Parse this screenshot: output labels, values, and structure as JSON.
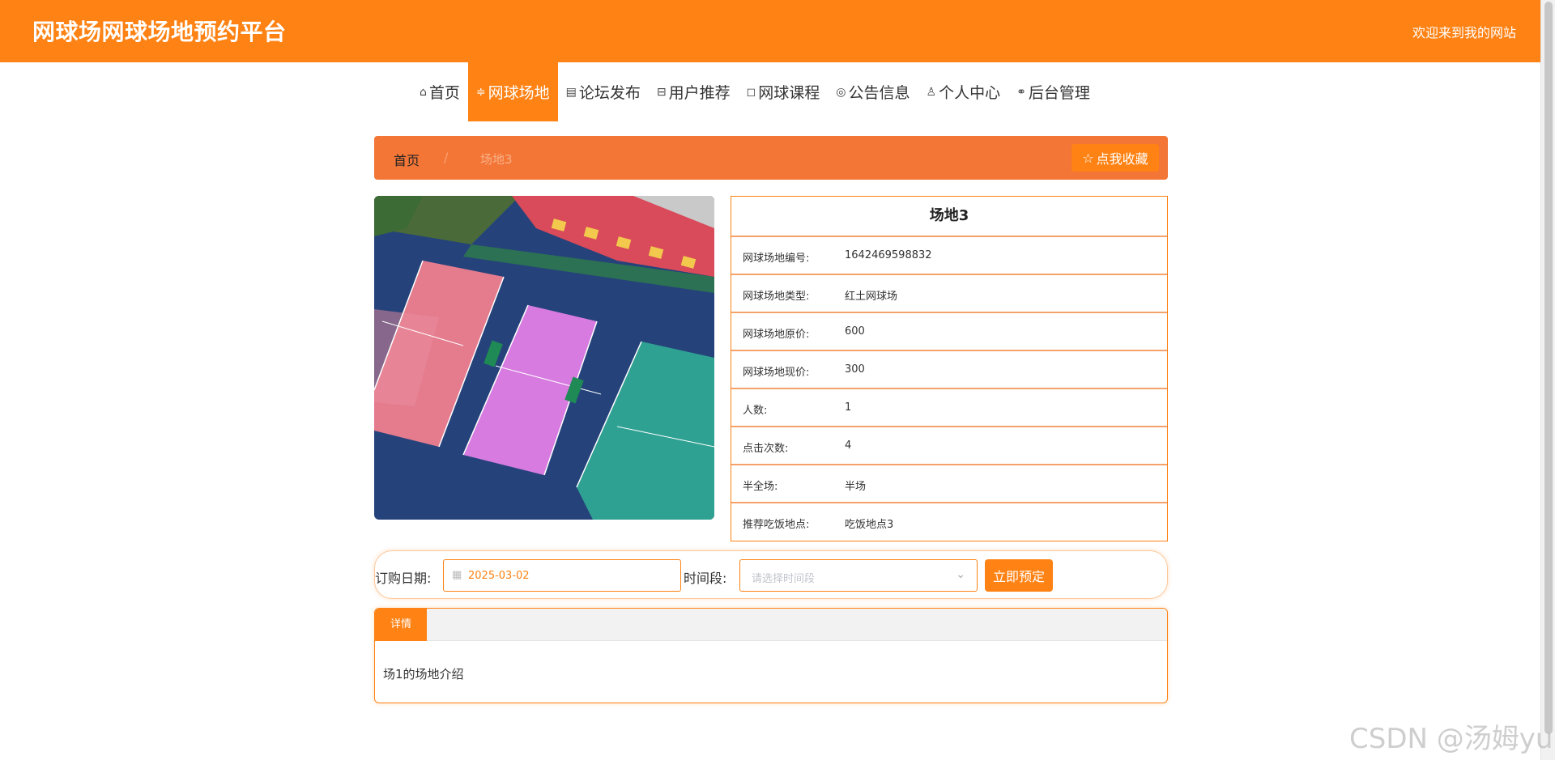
{
  "header": {
    "site_title": "网球场网球场地预约平台",
    "welcome_text": "欢迎来到我的网站"
  },
  "nav": {
    "items": [
      {
        "label": "首页",
        "icon": "home-icon"
      },
      {
        "label": "网球场地",
        "icon": "sliders-icon",
        "active": true
      },
      {
        "label": "论坛发布",
        "icon": "calendar-icon"
      },
      {
        "label": "用户推荐",
        "icon": "gift-icon"
      },
      {
        "label": "网球课程",
        "icon": "tag-icon"
      },
      {
        "label": "公告信息",
        "icon": "globe-icon"
      },
      {
        "label": "个人中心",
        "icon": "user-icon"
      },
      {
        "label": "后台管理",
        "icon": "link-icon"
      }
    ]
  },
  "breadcrumb": {
    "home": "首页",
    "separator": "/",
    "current": "场地3",
    "collect_label": "点我收藏"
  },
  "court": {
    "name": "场地3",
    "fields": [
      {
        "label": "网球场地编号:",
        "value": "1642469598832"
      },
      {
        "label": "网球场地类型:",
        "value": "红土网球场"
      },
      {
        "label": "网球场地原价:",
        "value": "600"
      },
      {
        "label": "网球场地现价:",
        "value": "300"
      },
      {
        "label": "人数:",
        "value": "1"
      },
      {
        "label": "点击次数:",
        "value": "4"
      },
      {
        "label": "半全场:",
        "value": "半场"
      },
      {
        "label": "推荐吃饭地点:",
        "value": "吃饭地点3"
      }
    ]
  },
  "booking": {
    "date_label": "订购日期:",
    "date_value": "2025-03-02",
    "time_label": "时间段:",
    "time_placeholder": "请选择时间段",
    "submit_label": "立即预定"
  },
  "details": {
    "tab_label": "详情",
    "content": "场1的场地介绍"
  },
  "watermark": "CSDN @汤姆yu",
  "colors": {
    "primary": "#fe8214",
    "breadcrumb_bg": "#f47637"
  }
}
